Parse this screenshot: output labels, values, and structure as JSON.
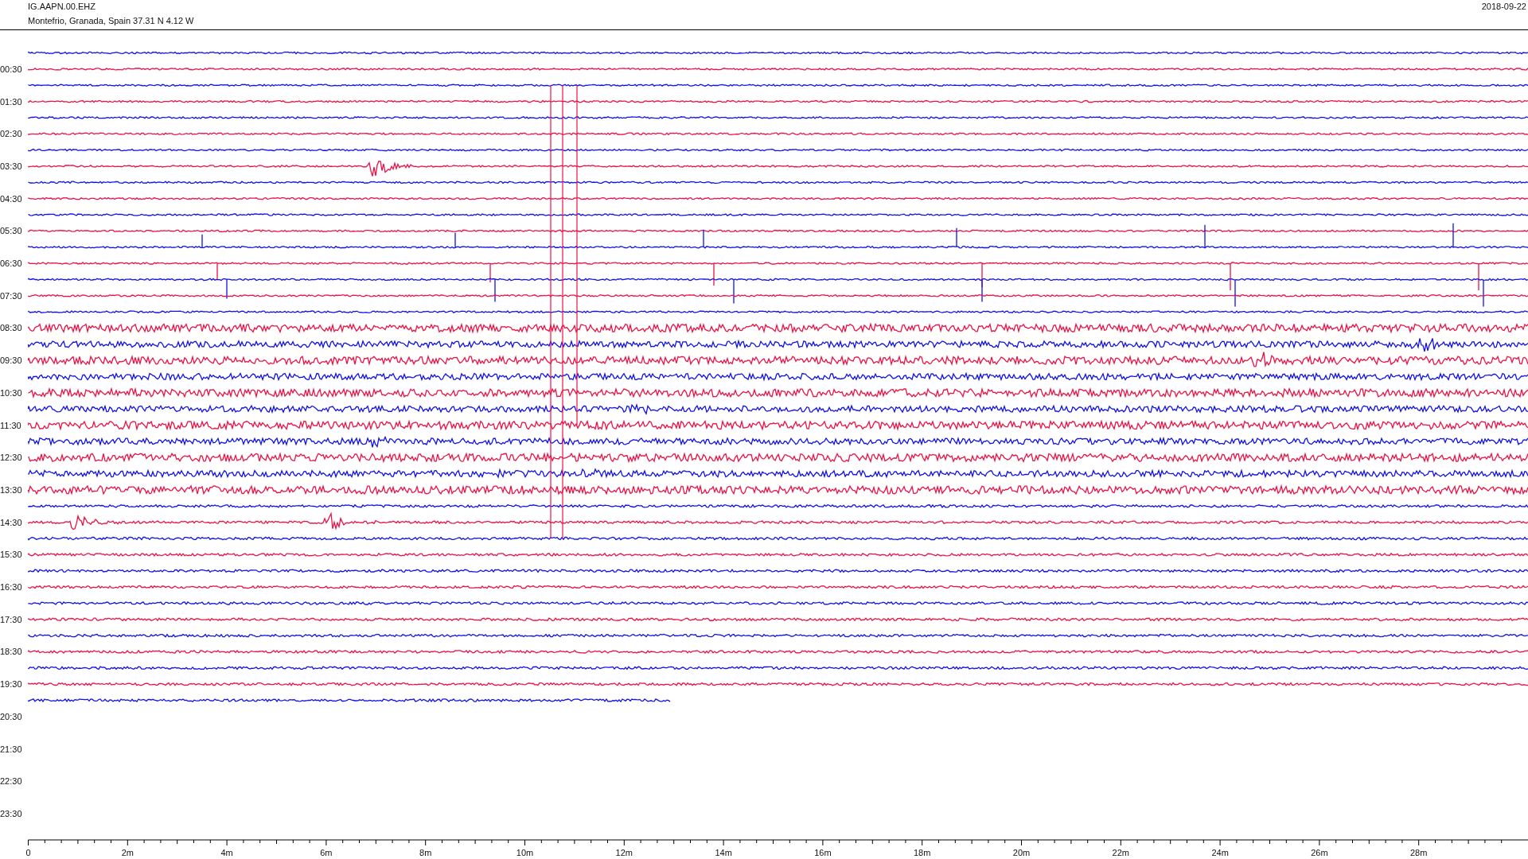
{
  "header": {
    "station": "IG.AAPN.00.EHZ",
    "location": "Montefrio, Granada, Spain  37.31 N 4.12 W",
    "date": "2018-09-22"
  },
  "time_labels": [
    "00:30",
    "01:30",
    "02:30",
    "03:30",
    "04:30",
    "05:30",
    "06:30",
    "07:30",
    "08:30",
    "09:30",
    "10:30",
    "11:30",
    "12:30",
    "13:30",
    "14:30",
    "15:30",
    "16:30",
    "17:30",
    "18:30",
    "19:30",
    "20:30",
    "21:30",
    "22:30",
    "23:30"
  ],
  "x_axis_labels": [
    "0",
    "2m",
    "4m",
    "6m",
    "8m",
    "10m",
    "12m",
    "14m",
    "16m",
    "18m",
    "20m",
    "22m",
    "24m",
    "26m",
    "28m"
  ]
}
